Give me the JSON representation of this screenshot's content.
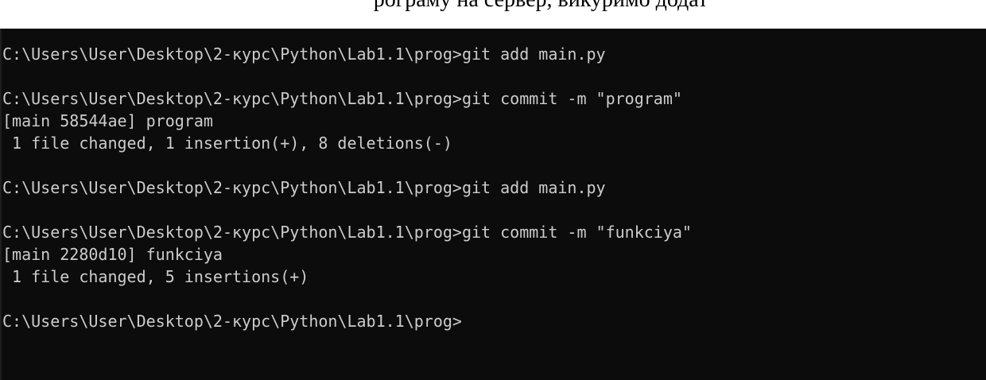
{
  "document": {
    "cut_off_caption": "рограму на сервер, викуримо додат"
  },
  "terminal": {
    "lines": [
      "C:\\Users\\User\\Desktop\\2-курс\\Python\\Lab1.1\\prog>git add main.py",
      "",
      "C:\\Users\\User\\Desktop\\2-курс\\Python\\Lab1.1\\prog>git commit -m \"program\"",
      "[main 58544ae] program",
      " 1 file changed, 1 insertion(+), 8 deletions(-)",
      "",
      "C:\\Users\\User\\Desktop\\2-курс\\Python\\Lab1.1\\prog>git add main.py",
      "",
      "C:\\Users\\User\\Desktop\\2-курс\\Python\\Lab1.1\\prog>git commit -m \"funkciya\"",
      "[main 2280d10] funkciya",
      " 1 file changed, 5 insertions(+)",
      "",
      "C:\\Users\\User\\Desktop\\2-курс\\Python\\Lab1.1\\prog>"
    ]
  },
  "colors": {
    "terminal_bg": "#0c0c0c",
    "terminal_fg": "#cccccc",
    "page_bg": "#ffffff"
  }
}
